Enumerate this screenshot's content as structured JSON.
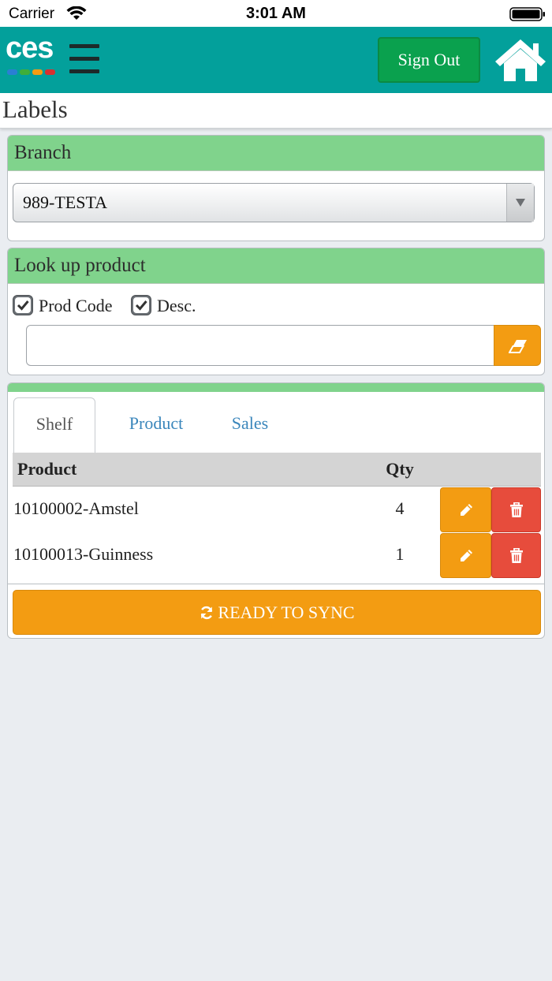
{
  "status_bar": {
    "carrier": "Carrier",
    "time": "3:01 AM"
  },
  "header": {
    "logo_text": "ces",
    "logo_dot_colors": [
      "#2a7fd4",
      "#3fae3a",
      "#f39c12",
      "#d93030"
    ],
    "sign_out_label": "Sign Out",
    "accent_color": "#03a09b"
  },
  "page": {
    "title": "Labels"
  },
  "branch": {
    "heading": "Branch",
    "selected": "989-TESTA"
  },
  "lookup": {
    "heading": "Look up product",
    "prod_code_label": "Prod Code",
    "prod_code_checked": true,
    "desc_label": "Desc.",
    "desc_checked": true,
    "search_value": ""
  },
  "tabs": [
    {
      "label": "Shelf",
      "active": true
    },
    {
      "label": "Product",
      "active": false
    },
    {
      "label": "Sales",
      "active": false
    }
  ],
  "table": {
    "columns": [
      "Product",
      "Qty"
    ],
    "rows": [
      {
        "product": "10100002-Amstel",
        "qty": "4"
      },
      {
        "product": "10100013-Guinness",
        "qty": "1"
      }
    ]
  },
  "sync_label": "READY TO SYNC",
  "colors": {
    "panel_header": "#80d38c",
    "warning": "#f39c12",
    "danger": "#e74c3c",
    "success": "#0aa14e",
    "link": "#3a86bb"
  }
}
